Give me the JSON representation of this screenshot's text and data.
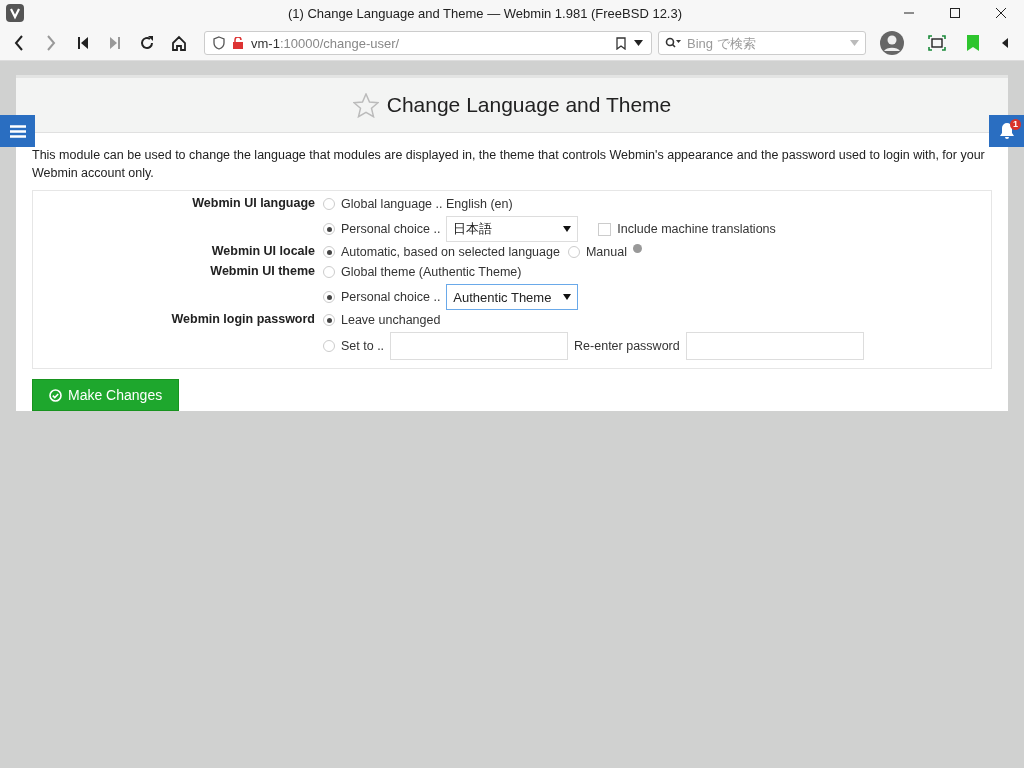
{
  "window": {
    "title": "(1) Change Language and Theme — Webmin 1.981 (FreeBSD 12.3)"
  },
  "toolbar": {
    "address_host": "vm-1",
    "address_rest": ":10000/change-user/",
    "search_placeholder": "Bing で検索"
  },
  "notifications": {
    "count": "1"
  },
  "page": {
    "title": "Change Language and Theme",
    "description": "This module can be used to change the language that modules are displayed in, the theme that controls Webmin's appearance and the password used to login with, for your Webmin account only."
  },
  "fields": [
    {
      "label": "Webmin UI language",
      "inline": false,
      "options": [
        {
          "kind": "radio",
          "label": "Global language .. English (en)",
          "selected": false
        },
        {
          "kind": "select",
          "label": "Personal choice ..",
          "selected": true,
          "value": "日本語",
          "focused": false,
          "checkbox": {
            "label": "Include machine translations",
            "checked": false
          }
        }
      ]
    },
    {
      "label": "Webmin UI locale",
      "inline": true,
      "options": [
        {
          "kind": "radio",
          "label": "Automatic, based on selected language",
          "selected": true
        },
        {
          "kind": "radio",
          "label": "Manual",
          "selected": false,
          "help": true
        }
      ]
    },
    {
      "label": "Webmin UI theme",
      "inline": false,
      "options": [
        {
          "kind": "radio",
          "label": "Global theme (Authentic Theme)",
          "selected": false
        },
        {
          "kind": "select",
          "label": "Personal choice ..",
          "selected": true,
          "value": "Authentic Theme",
          "focused": true
        }
      ]
    },
    {
      "label": "Webmin login password",
      "inline": false,
      "options": [
        {
          "kind": "radio",
          "label": "Leave unchanged",
          "selected": true
        },
        {
          "kind": "password",
          "label": "Set to ..",
          "selected": false,
          "confirm_label": "Re-enter password"
        }
      ]
    }
  ],
  "submit": {
    "label": "Make Changes"
  }
}
